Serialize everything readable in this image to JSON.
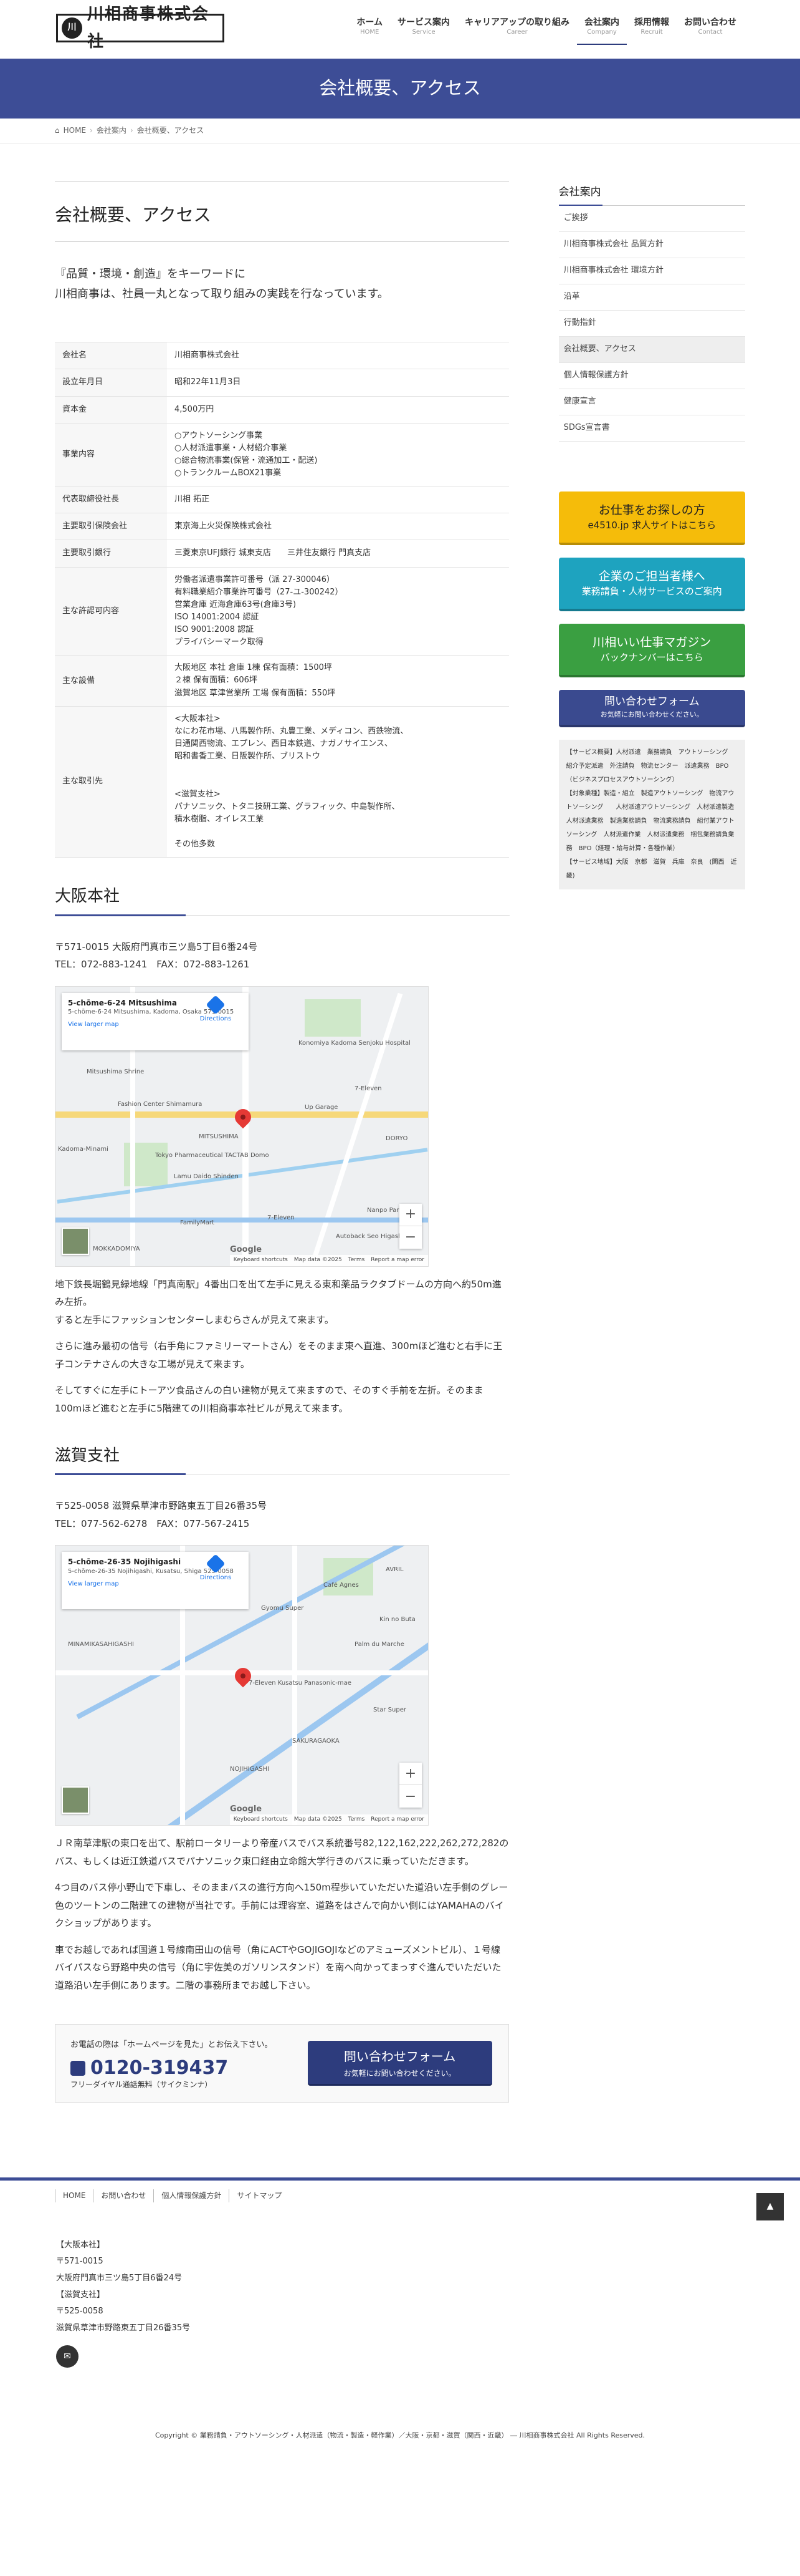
{
  "header": {
    "logo_mark": "川",
    "logo_text": "川相商事株式会社",
    "nav": [
      {
        "label": "ホーム",
        "sub": "HOME"
      },
      {
        "label": "サービス案内",
        "sub": "Service"
      },
      {
        "label": "キャリアアップの取り組み",
        "sub": "Career"
      },
      {
        "label": "会社案内",
        "sub": "Company"
      },
      {
        "label": "採用情報",
        "sub": "Recruit"
      },
      {
        "label": "お問い合わせ",
        "sub": "Contact"
      }
    ]
  },
  "banner": {
    "title": "会社概要、アクセス"
  },
  "breadcrumb": {
    "home": "HOME",
    "parent": "会社案内",
    "current": "会社概要、アクセス"
  },
  "main": {
    "title": "会社概要、アクセス",
    "lead_1": "『品質・環境・創造』をキーワードに",
    "lead_2": "川相商事は、社員一丸となって取り組みの実践を行なっています。",
    "table": [
      {
        "label": "会社名",
        "value": "川相商事株式会社"
      },
      {
        "label": "設立年月日",
        "value": "昭和22年11月3日"
      },
      {
        "label": "資本金",
        "value": "4,500万円"
      },
      {
        "label": "事業内容",
        "value": "○アウトソーシング事業\n○人材派遣事業・人材紹介事業\n○総合物流事業(保管・流通加工・配送)\n○トランクルームBOX21事業"
      },
      {
        "label": "代表取締役社長",
        "value": "川相 拓正"
      },
      {
        "label": "主要取引保険会社",
        "value": "東京海上火災保険株式会社"
      },
      {
        "label": "主要取引銀行",
        "value": "三菱東京UFJ銀行 城東支店　　三井住友銀行 門真支店"
      },
      {
        "label": "主な許認可内容",
        "value": "労働者派遣事業許可番号（派 27-300046）\n有料職業紹介事業許可番号（27-ユ-300242）\n営業倉庫 近海倉庫63号(倉庫3号)\nISO 14001:2004 認証\nISO 9001:2008 認証\nプライバシーマーク取得"
      },
      {
        "label": "主な設備",
        "value": "大阪地区 本社 倉庫 1棟 保有面積：1500坪\n２棟 保有面積：606坪\n滋賀地区 草津営業所 工場 保有面積：550坪"
      },
      {
        "label": "主な取引先",
        "value": "<大阪本社>\nなにわ花市場、八馬製作所、丸豊工業、メディコン、西鉄物流、\n日通関西物流、エプレン、西日本鉄道、ナガノサイエンス、\n昭和書香工業、日阪製作所、ブリストウ\n\n\n<滋賀支社>\nパナソニック、トタニ技研工業、グラフィック、中島製作所、\n積水樹脂、オイレス工業\n\nその他多数"
      }
    ],
    "osaka": {
      "heading": "大阪本社",
      "address": "〒571-0015 大阪府門真市三ツ島5丁目6番24号",
      "tel": "TEL：072-883-1241　FAX：072-883-1261",
      "map_place": "5-chōme-6-24 Mitsushima",
      "map_address": "5-chōme-6-24 Mitsushima, Kadoma, Osaka 571-0015",
      "map_larger": "View larger map",
      "map_directions": "Directions",
      "map_footer": [
        "Keyboard shortcuts",
        "Map data ©2025",
        "Terms",
        "Report a map error"
      ],
      "map_labels": [
        "Mitsushima Shrine",
        "Fashion Center Shimamura",
        "MITSUSHIMA",
        "Tokyo Pharmaceutical TACTAB Domo",
        "Lamu Daido Shinden",
        "Konomiya Kadoma Senjoku Hospital",
        "7-Eleven",
        "Up Garage",
        "DORYO",
        "Nanpo Park",
        "FamilyMart",
        "7-Eleven",
        "Autoback Seo Higashiosaka",
        "MOKKADOMIYA",
        "Kadoma-Minami"
      ],
      "para_1": "地下鉄長堀鶴見緑地線「門真南駅」4番出口を出て左手に見える東和薬品ラクタブドームの方向へ約50m進み左折。",
      "para_2": "すると左手にファッションセンターしまむらさんが見えて来ます。",
      "para_3": "さらに進み最初の信号（右手角にファミリーマートさん）をそのまま東へ直進、300mほど進むと右手に王子コンテナさんの大きな工場が見えて来ます。",
      "para_4": "そしてすぐに左手にトーアツ食品さんの白い建物が見えて来ますので、そのすぐ手前を左折。そのまま100mほど進むと左手に5階建ての川相商事本社ビルが見えて来ます。"
    },
    "shiga": {
      "heading": "滋賀支社",
      "address": "〒525-0058 滋賀県草津市野路東五丁目26番35号",
      "tel": "TEL：077-562-6278　FAX：077-567-2415",
      "map_place": "5-chōme-26-35 Nojihigashi",
      "map_address": "5-chōme-26-35 Nojihigashi, Kusatsu, Shiga 525-0058",
      "map_larger": "View larger map",
      "map_directions": "Directions",
      "map_footer": [
        "Keyboard shortcuts",
        "Map data ©2025",
        "Terms",
        "Report a map error"
      ],
      "map_labels": [
        "MINAMIKASAHIGASHI",
        "Gyomu Super",
        "Kin no Buta",
        "Palm du Marche",
        "7-Eleven Kusatsu Panasonic-mae",
        "Star Super",
        "SAKURAGAOKA",
        "NOJIHIGASHI",
        "Café Agnes",
        "AVRIL"
      ],
      "para_1": "ＪＲ南草津駅の東口を出て、駅前ロータリーより帝産バスでバス系統番号82,122,162,222,262,272,282のバス、もしくは近江鉄道バスでパナソニック東口経由立命館大学行きのバスに乗っていただきます。",
      "para_2": "4つ目のバス停小野山で下車し、そのままバスの進行方向へ150m程歩いていただいた道沿い左手側のグレー色のツートンの二階建ての建物が当社です。手前には理容室、道路をはさんで向かい側にはYAMAHAのバイクショップがあります。",
      "para_3": "車でお越しであれば国道１号線南田山の信号（角にACTやGOJIGOJIなどのアミューズメントビル）、１号線バイパスなら野路中央の信号（角に宇佐美のガソリンスタンド）を南へ向かってまっすぐ進んでいただいた道路沿い左手側にあります。二階の事務所までお越し下さい。"
    },
    "contact": {
      "note": "お電話の際は「ホームページを見た」とお伝え下さい。",
      "phone": "0120-319437",
      "free": "フリーダイヤル通話無料（サイクミンナ）",
      "btn_big": "問い合わせフォーム",
      "btn_small": "お気軽にお問い合わせください。"
    }
  },
  "sidebar": {
    "title": "会社案内",
    "items": [
      "ご挨拶",
      "川相商事株式会社 品質方針",
      "川相商事株式会社 環境方針",
      "沿革",
      "行動指針",
      "会社概要、アクセス",
      "個人情報保護方針",
      "健康宣言",
      "SDGs宣言書"
    ],
    "banner_1_a": "お仕事をお探しの方",
    "banner_1_b": "e4510.jp 求人サイトはこちら",
    "banner_2_a": "企業のご担当者様へ",
    "banner_2_b": "業務請負・人材サービスのご案内",
    "banner_3_a": "川相いい仕事マガジン",
    "banner_3_b": "バックナンバーはこちら",
    "banner_4_a": "問い合わせフォーム",
    "banner_4_b": "お気軽にお問い合わせください。",
    "tags": "【サービス概要】人材派遣　業務請負　アウトソーシング　紹介予定派遣　外注請負　物流センター　派遣業務　BPO（ビジネスプロセスアウトソーシング）\n【対象業種】製造・組立　製造アウトソーシング　物流アウトソーシング　　人材派遣アウトソーシング　人材派遣製造　人材派遣業務　製造業務請負　物流業務請負　組付業アウトソーシング　人材派遣作業　人材派遣業務　梱包業務請負業務　BPO（経理・給与計算・各種作業）\n【サービス地域】大阪　京都　滋賀　兵庫　奈良　(関西　近畿)"
  },
  "footer": {
    "nav": [
      "HOME",
      "お問い合わせ",
      "個人情報保護方針",
      "サイトマップ"
    ],
    "address": "【大阪本社】\n〒571-0015\n大阪府門真市三ツ島5丁目6番24号\n【滋賀支社】\n〒525-0058\n滋賀県草津市野路東五丁目26番35号",
    "copyright": "Copyright © 業務請負・アウトソーシング・人材派遣（物流・製造・軽作業）／大阪・京都・滋賀（関西・近畿） ― 川相商事株式会社 All Rights Reserved."
  }
}
